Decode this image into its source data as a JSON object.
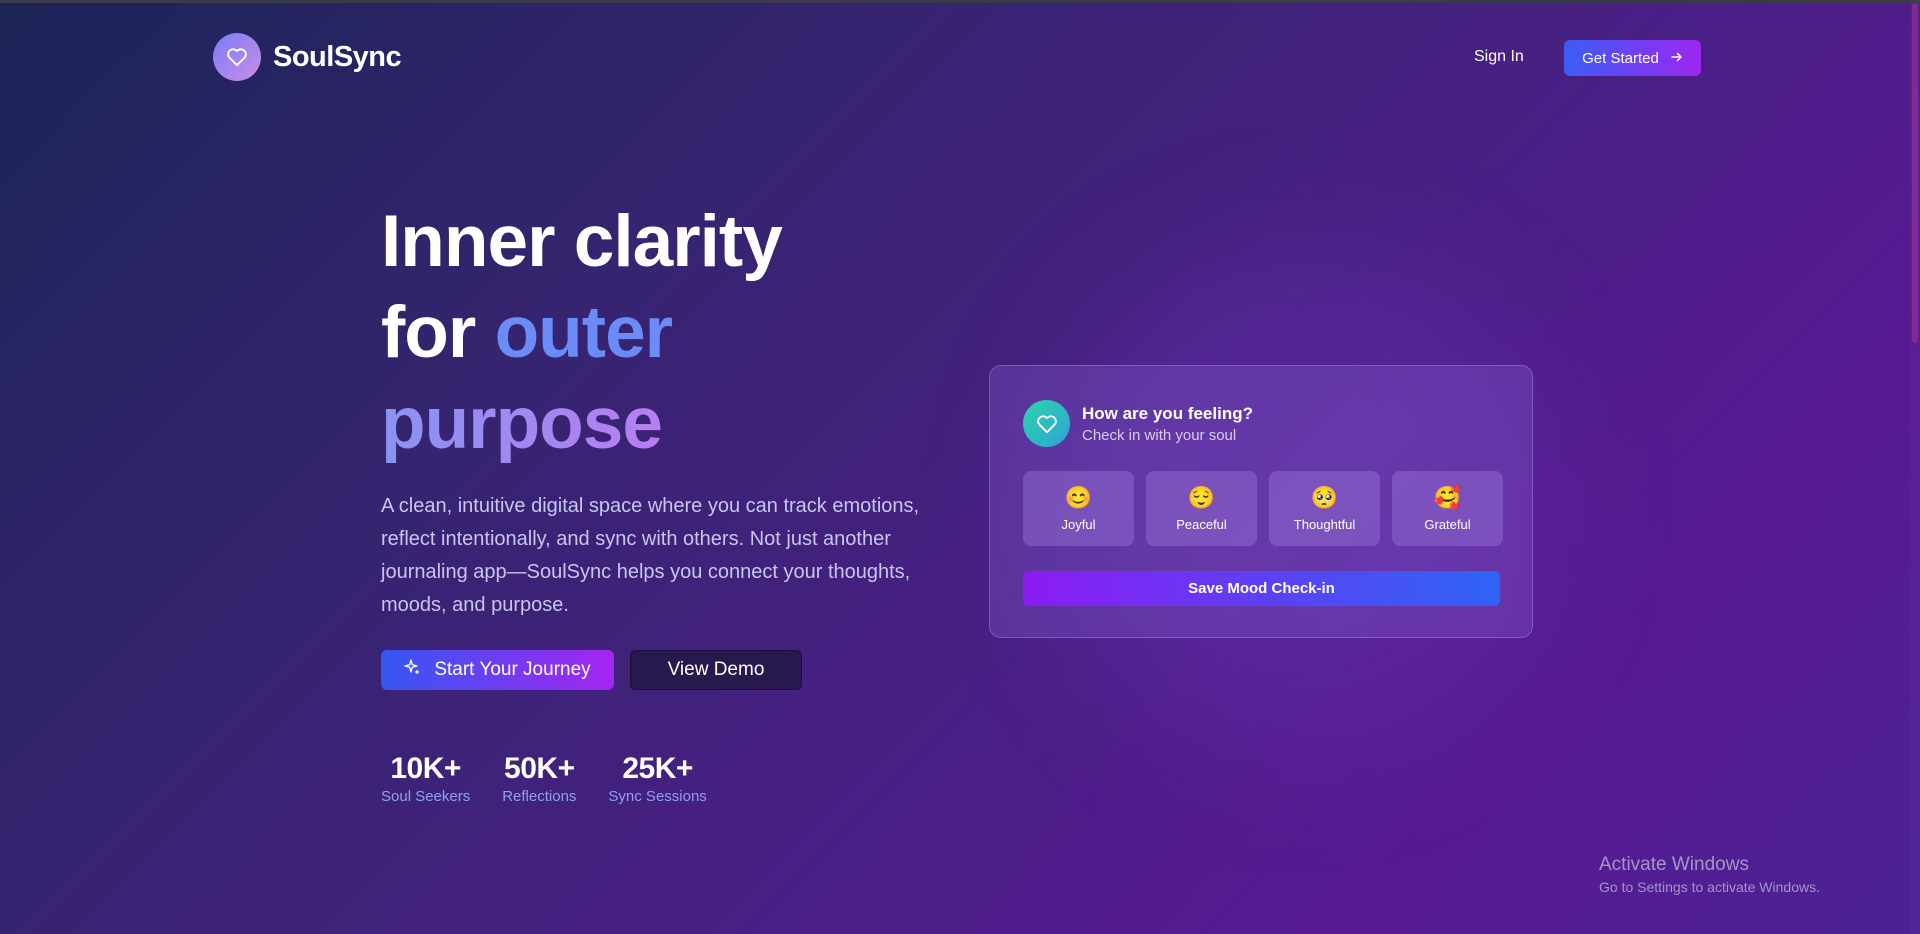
{
  "nav": {
    "brand": "SoulSync",
    "signin_label": "Sign In",
    "getstarted_label": "Get Started"
  },
  "hero": {
    "headline_line1": "Inner clarity",
    "headline_for": "for ",
    "headline_outer": "outer",
    "headline_purpose": "purpose",
    "description": "A clean, intuitive digital space where you can track emotions, reflect intentionally, and sync with others. Not just another journaling app—SoulSync helps you connect your thoughts, moods, and purpose.",
    "primary_cta": "Start Your Journey",
    "secondary_cta": "View Demo"
  },
  "stats": [
    {
      "value": "10K+",
      "label": "Soul Seekers"
    },
    {
      "value": "50K+",
      "label": "Reflections"
    },
    {
      "value": "25K+",
      "label": "Sync Sessions"
    }
  ],
  "mood_card": {
    "title": "How are you feeling?",
    "subtitle": "Check in with your soul",
    "moods": [
      {
        "emoji": "😊",
        "label": "Joyful"
      },
      {
        "emoji": "😌",
        "label": "Peaceful"
      },
      {
        "emoji": "🥺",
        "label": "Thoughtful"
      },
      {
        "emoji": "🥰",
        "label": "Grateful"
      }
    ],
    "save_label": "Save Mood Check-in"
  },
  "watermark": {
    "title": "Activate Windows",
    "subtitle": "Go to Settings to activate Windows."
  },
  "colors": {
    "accent_blue": "#3b5df5",
    "accent_purple": "#9d27f0",
    "teal": "#2dd4a8"
  }
}
